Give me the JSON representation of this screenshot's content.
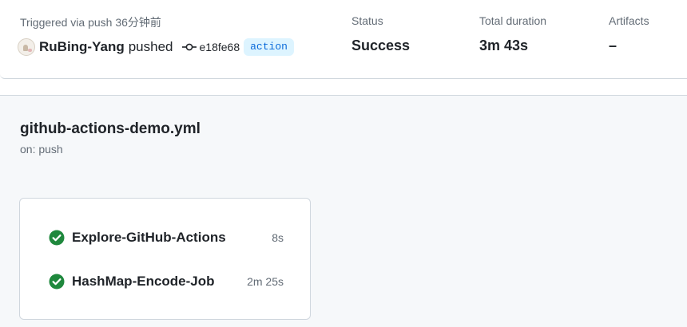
{
  "summary": {
    "trigger_label": "Triggered via push 36分钟前",
    "user": "RuBing-Yang",
    "action_word": "pushed",
    "commit_sha": "e18fe68",
    "branch": "action",
    "status_label": "Status",
    "status_value": "Success",
    "duration_label": "Total duration",
    "duration_value": "3m 43s",
    "artifacts_label": "Artifacts",
    "artifacts_value": "–"
  },
  "workflow": {
    "file_name": "github-actions-demo.yml",
    "event": "on: push",
    "jobs": [
      {
        "name": "Explore-GitHub-Actions",
        "duration": "8s",
        "status": "success",
        "icon": "check-circle-icon"
      },
      {
        "name": "HashMap-Encode-Job",
        "duration": "2m 25s",
        "status": "success",
        "icon": "check-circle-icon"
      }
    ]
  },
  "colors": {
    "success": "#1f883d",
    "branch_bg": "#ddf4ff",
    "branch_fg": "#0969da",
    "muted_text": "#636c76",
    "graph_bg": "#f6f8fa"
  }
}
